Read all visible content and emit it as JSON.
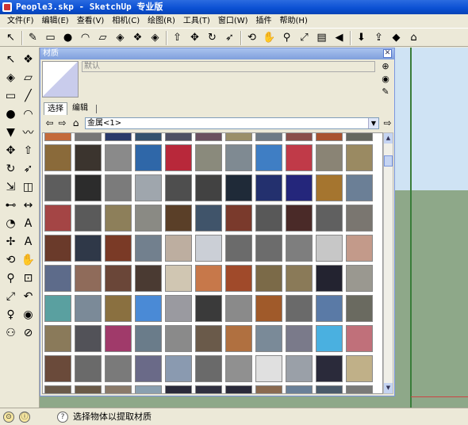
{
  "window": {
    "title": "People3.skp - SketchUp 专业版"
  },
  "menu": [
    "文件(F)",
    "编辑(E)",
    "查看(V)",
    "相机(C)",
    "绘图(R)",
    "工具(T)",
    "窗口(W)",
    "插件",
    "帮助(H)"
  ],
  "toolbar_icons": [
    "select-icon",
    "pencil-icon",
    "rectangle-icon",
    "circle-icon",
    "arc-icon",
    "eraser-icon",
    "paint-bucket-icon",
    "make-component-icon",
    "paint-icon",
    "push-pull-icon",
    "move-icon",
    "rotate-icon",
    "follow-me-icon",
    "orbit-icon",
    "pan-icon",
    "zoom-icon",
    "zoom-extents-icon",
    "section-icon",
    "previous-view-icon",
    "get-models-icon",
    "share-icon",
    "component-icon",
    "3d-warehouse-icon"
  ],
  "materials_panel": {
    "title": "材质",
    "name_field": "默认",
    "tabs": [
      "选择",
      "编辑"
    ],
    "library": "金属<1>",
    "swatch_colors": [
      [
        "#c46a3a",
        "#777",
        "#2a3a6a",
        "#34526e",
        "#4e5064",
        "#6b5060",
        "#9a8f6a",
        "#6e7a86",
        "#8a4f4a",
        "#a9532f",
        "#656860"
      ],
      [
        "#8a6a3a",
        "#3b342e",
        "#8a8a8a",
        "#2f67a8",
        "#b8283a",
        "#8a8a7c",
        "#7f8a92",
        "#3f7ec4",
        "#c03a48",
        "#8a8475",
        "#9a8a62"
      ],
      [
        "#5d5d5d",
        "#2c2c2c",
        "#7b7b7b",
        "#9fa6ad",
        "#4e4e4e",
        "#424242",
        "#1f2a38",
        "#23306e",
        "#24267b",
        "#a5752f",
        "#6b7f96"
      ],
      [
        "#a44545",
        "#5a5a5a",
        "#8d7f5a",
        "#8a8a84",
        "#5a3f28",
        "#40546a",
        "#7a3a2c",
        "#585858",
        "#4a2a28",
        "#606060",
        "#7a7670"
      ],
      [
        "#6a3a2a",
        "#2f3848",
        "#7a3a26",
        "#72808e",
        "#bdaea0",
        "#cbcfd6",
        "#6b6b6b",
        "#6c6c6c",
        "#7e7e7e",
        "#c7c7c7",
        "#c39a8a"
      ],
      [
        "#5d6b8a",
        "#8f6b5a",
        "#6a4638",
        "#4a3a32",
        "#d0c6b2",
        "#c7784a",
        "#a04a2a",
        "#7b6a48",
        "#8a7a58",
        "#232330",
        "#9a9890"
      ],
      [
        "#5aa0a0",
        "#7b8a98",
        "#8a7040",
        "#4a8ad6",
        "#9a9aa0",
        "#3a3a3a",
        "#8a8a8a",
        "#a05a2a",
        "#6a6a6a",
        "#5a7aa6",
        "#6a6a60"
      ],
      [
        "#8a7a5a",
        "#525258",
        "#a03a6a",
        "#6a7c8a",
        "#8a8a8a",
        "#6a5a4a",
        "#b07040",
        "#7a8a98",
        "#7a7a8a",
        "#4ab0e0",
        "#c0707a"
      ],
      [
        "#6a4a3a",
        "#6a6a6a",
        "#7a7a7a",
        "#6a6a88",
        "#8a9ab0",
        "#6a6a6a",
        "#909090",
        "#e0e0e0",
        "#9aa0a8",
        "#2a2a3a",
        "#c0b088"
      ],
      [
        "#6a5a4a",
        "#6a5a48",
        "#8a7a6a",
        "#8aa0b0",
        "#2a2a3a",
        "#303040",
        "#2a2a3a",
        "#8a6a50",
        "#6a8098",
        "#4a5a6a",
        "#7a7a78"
      ]
    ]
  },
  "left_toolbar_icons": [
    "select-icon",
    "make-component-icon",
    "paint-icon",
    "eraser-icon",
    "rectangle-icon",
    "line-icon",
    "circle-icon",
    "arc-icon",
    "polygon-icon",
    "freehand-icon",
    "move-icon",
    "push-pull-icon",
    "rotate-icon",
    "follow-me-icon",
    "scale-icon",
    "offset-icon",
    "tape-measure-icon",
    "dimension-icon",
    "protractor-icon",
    "text-icon",
    "axes-icon",
    "3d-text-icon",
    "orbit-icon",
    "pan-icon",
    "zoom-icon",
    "zoom-window-icon",
    "zoom-extents-icon",
    "previous-icon",
    "position-camera-icon",
    "look-around-icon",
    "walk-icon",
    "section-plane-icon"
  ],
  "statusbar": {
    "text": "选择物体以提取材质",
    "icons": [
      "geolocation-icon",
      "credits-icon",
      "help-icon"
    ]
  }
}
